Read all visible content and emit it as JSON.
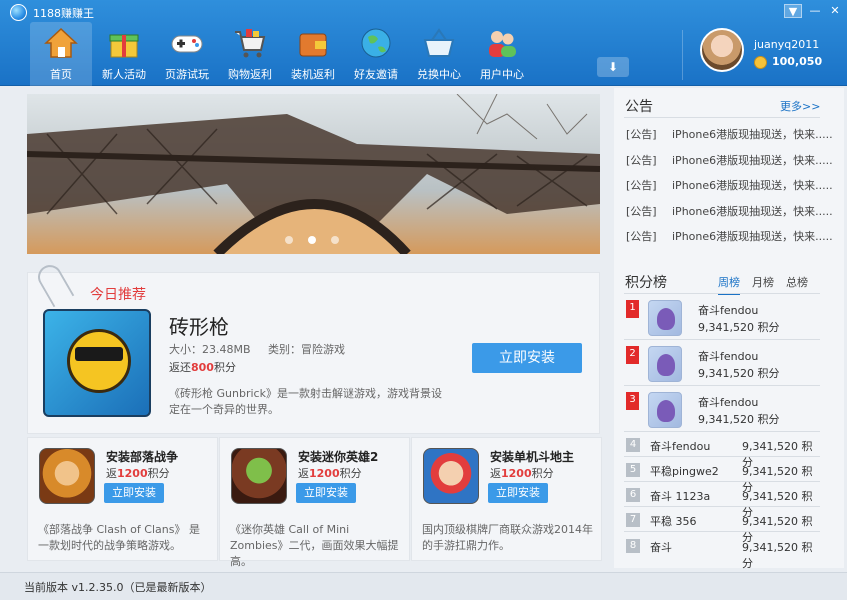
{
  "app": {
    "title": "1188赚赚王"
  },
  "nav": {
    "items": [
      {
        "label": "首页",
        "icon": "house-icon"
      },
      {
        "label": "新人活动",
        "icon": "gift-icon"
      },
      {
        "label": "页游试玩",
        "icon": "gamepad-icon"
      },
      {
        "label": "购物返利",
        "icon": "cart-icon"
      },
      {
        "label": "装机返利",
        "icon": "wallet-icon"
      },
      {
        "label": "好友邀请",
        "icon": "globe-icon"
      },
      {
        "label": "兑换中心",
        "icon": "basket-icon"
      },
      {
        "label": "用户中心",
        "icon": "users-icon"
      }
    ],
    "active_index": 0
  },
  "user": {
    "name": "juanyq2011",
    "coins": "100,050"
  },
  "banner": {
    "dots": 3,
    "active_dot": 1
  },
  "recommend": {
    "tag": "今日推荐",
    "name": "砖形枪",
    "size": "大小：23.48MB",
    "category": "类别：冒险游戏",
    "reward_prefix": "返还",
    "reward_value": "800",
    "reward_unit": "积分",
    "description": "《砖形枪 Gunbrick》是一款射击解谜游戏，游戏背景设定在一个奇异的世界。",
    "install_label": "立即安装"
  },
  "games": [
    {
      "title": "安装部落战争",
      "reward_prefix": "返",
      "reward_value": "1200",
      "reward_unit": "积分",
      "install_label": "立即安装",
      "description": "《部落战争 Clash of Clans》 是一款划时代的战争策略游戏。",
      "color": "#d88a2a"
    },
    {
      "title": "安装迷你英雄2",
      "reward_prefix": "返",
      "reward_value": "1200",
      "reward_unit": "积分",
      "install_label": "立即安装",
      "description": "《迷你英雄 Call of Mini Zombies》二代，画面效果大幅提高。",
      "color": "#7a3a22"
    },
    {
      "title": "安装单机斗地主",
      "reward_prefix": "返",
      "reward_value": "1200",
      "reward_unit": "积分",
      "install_label": "立即安装",
      "description": "国内顶级棋牌厂商联众游戏2014年的手游扛鼎力作。",
      "color": "#2f74c4"
    }
  ],
  "notice": {
    "title": "公告",
    "more": "更多>>",
    "items": [
      {
        "tag": "[公告]",
        "text": "iPhone6港版现抽现送，快来....."
      },
      {
        "tag": "[公告]",
        "text": "iPhone6港版现抽现送，快来....."
      },
      {
        "tag": "[公告]",
        "text": "iPhone6港版现抽现送，快来....."
      },
      {
        "tag": "[公告]",
        "text": "iPhone6港版现抽现送，快来....."
      },
      {
        "tag": "[公告]",
        "text": "iPhone6港版现抽现送，快来....."
      }
    ]
  },
  "ranking": {
    "title": "积分榜",
    "tabs": [
      "周榜",
      "月榜",
      "总榜"
    ],
    "active_tab": 0,
    "unit": "积分",
    "top": [
      {
        "rank": "1",
        "name": "奋斗fendou",
        "score": "9,341,520"
      },
      {
        "rank": "2",
        "name": "奋斗fendou",
        "score": "9,341,520"
      },
      {
        "rank": "3",
        "name": "奋斗fendou",
        "score": "9,341,520"
      }
    ],
    "rest": [
      {
        "rank": "4",
        "name": "奋斗fendou",
        "score": "9,341,520"
      },
      {
        "rank": "5",
        "name": "平稳pingwe2",
        "score": "9,341,520"
      },
      {
        "rank": "6",
        "name": "奋斗 1123a",
        "score": "9,341,520"
      },
      {
        "rank": "7",
        "name": "平稳 356",
        "score": "9,341,520"
      },
      {
        "rank": "8",
        "name": "奋斗",
        "score": "9,341,520"
      }
    ]
  },
  "status": {
    "version_text": "当前版本 v1.2.35.0（已是最新版本）"
  }
}
